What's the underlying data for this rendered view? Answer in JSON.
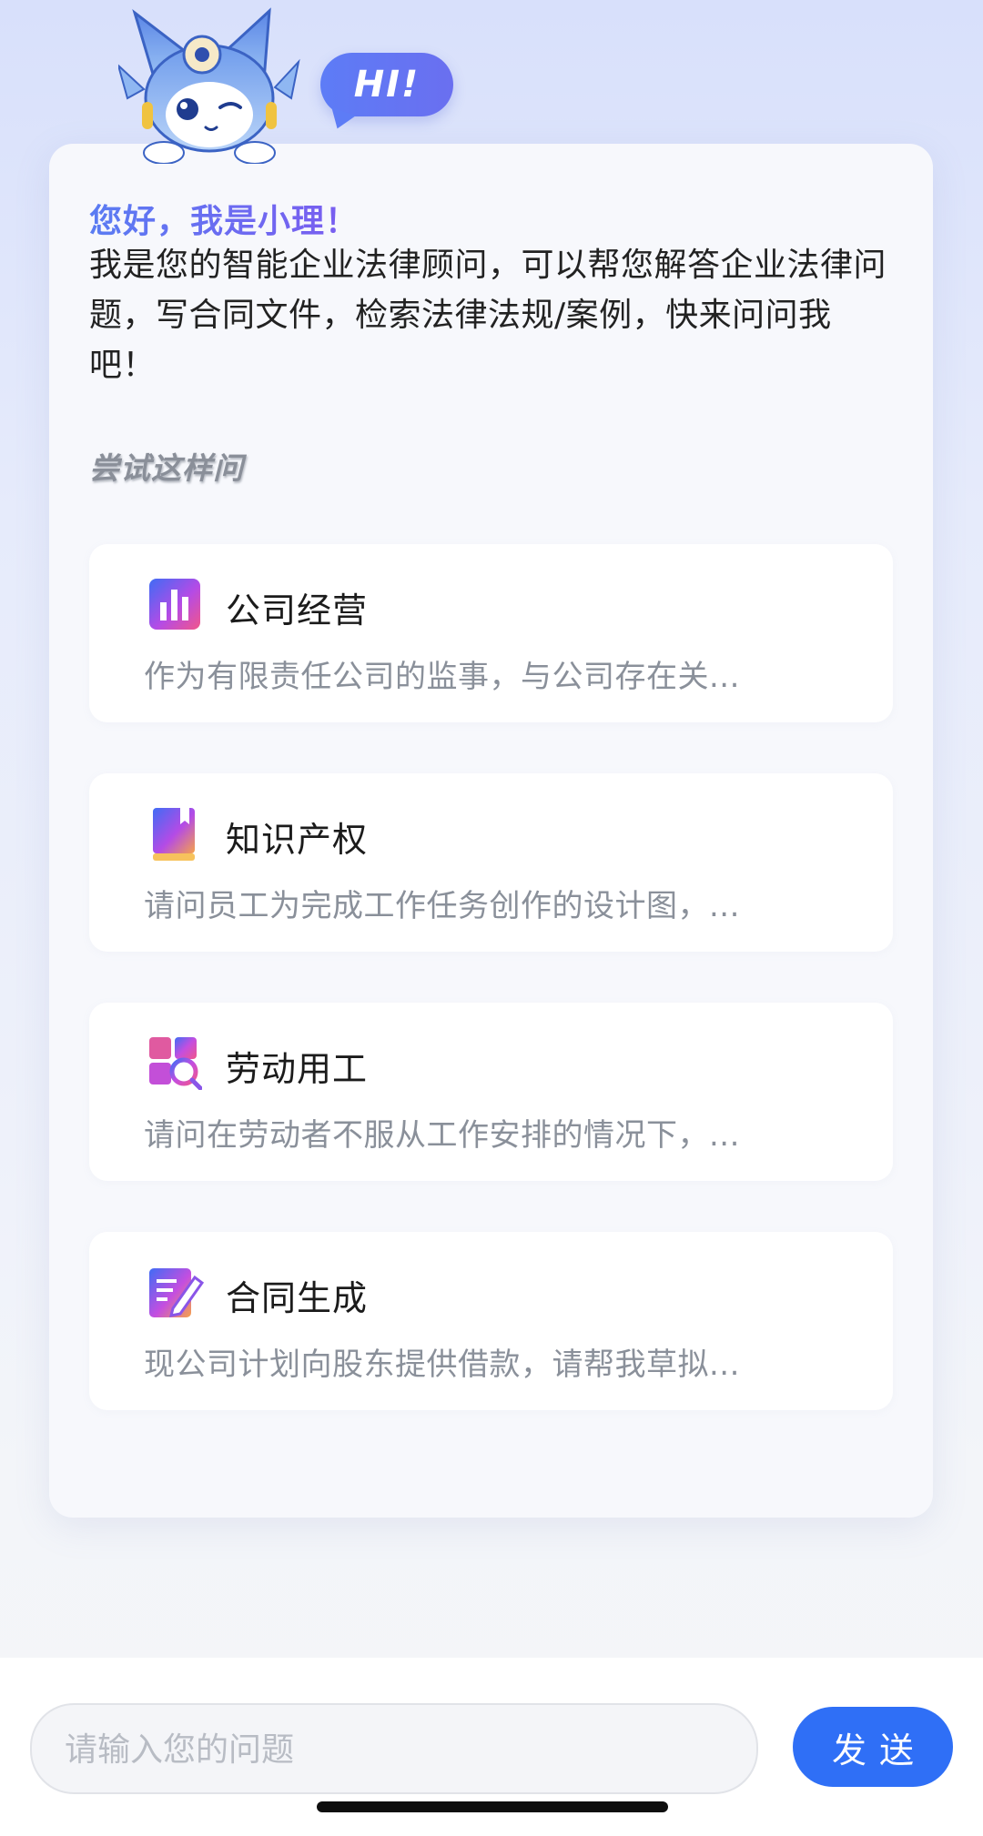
{
  "hi_bubble": {
    "text": "HI!"
  },
  "greeting": {
    "title": "您好，我是小理！",
    "body": "我是您的智能企业法律顾问，可以帮您解答企业法律问题，写合同文件，检索法律法规/案例，快来问问我吧！"
  },
  "try_label": "尝试这样问",
  "suggestions": [
    {
      "icon": "bar-chart-icon",
      "title": "公司经营",
      "desc": "作为有限责任公司的监事，与公司存在关..."
    },
    {
      "icon": "book-icon",
      "title": "知识产权",
      "desc": "请问员工为完成工作任务创作的设计图，..."
    },
    {
      "icon": "grid-search-icon",
      "title": "劳动用工",
      "desc": "请问在劳动者不服从工作安排的情况下，..."
    },
    {
      "icon": "document-edit-icon",
      "title": "合同生成",
      "desc": "现公司计划向股东提供借款，请帮我草拟..."
    }
  ],
  "input": {
    "placeholder": "请输入您的问题",
    "value": ""
  },
  "send_button": {
    "label": "发送"
  },
  "colors": {
    "accent": "#2f6ff6",
    "title_gradient_start": "#5a7cf2",
    "title_gradient_end": "#7b5cf0"
  }
}
